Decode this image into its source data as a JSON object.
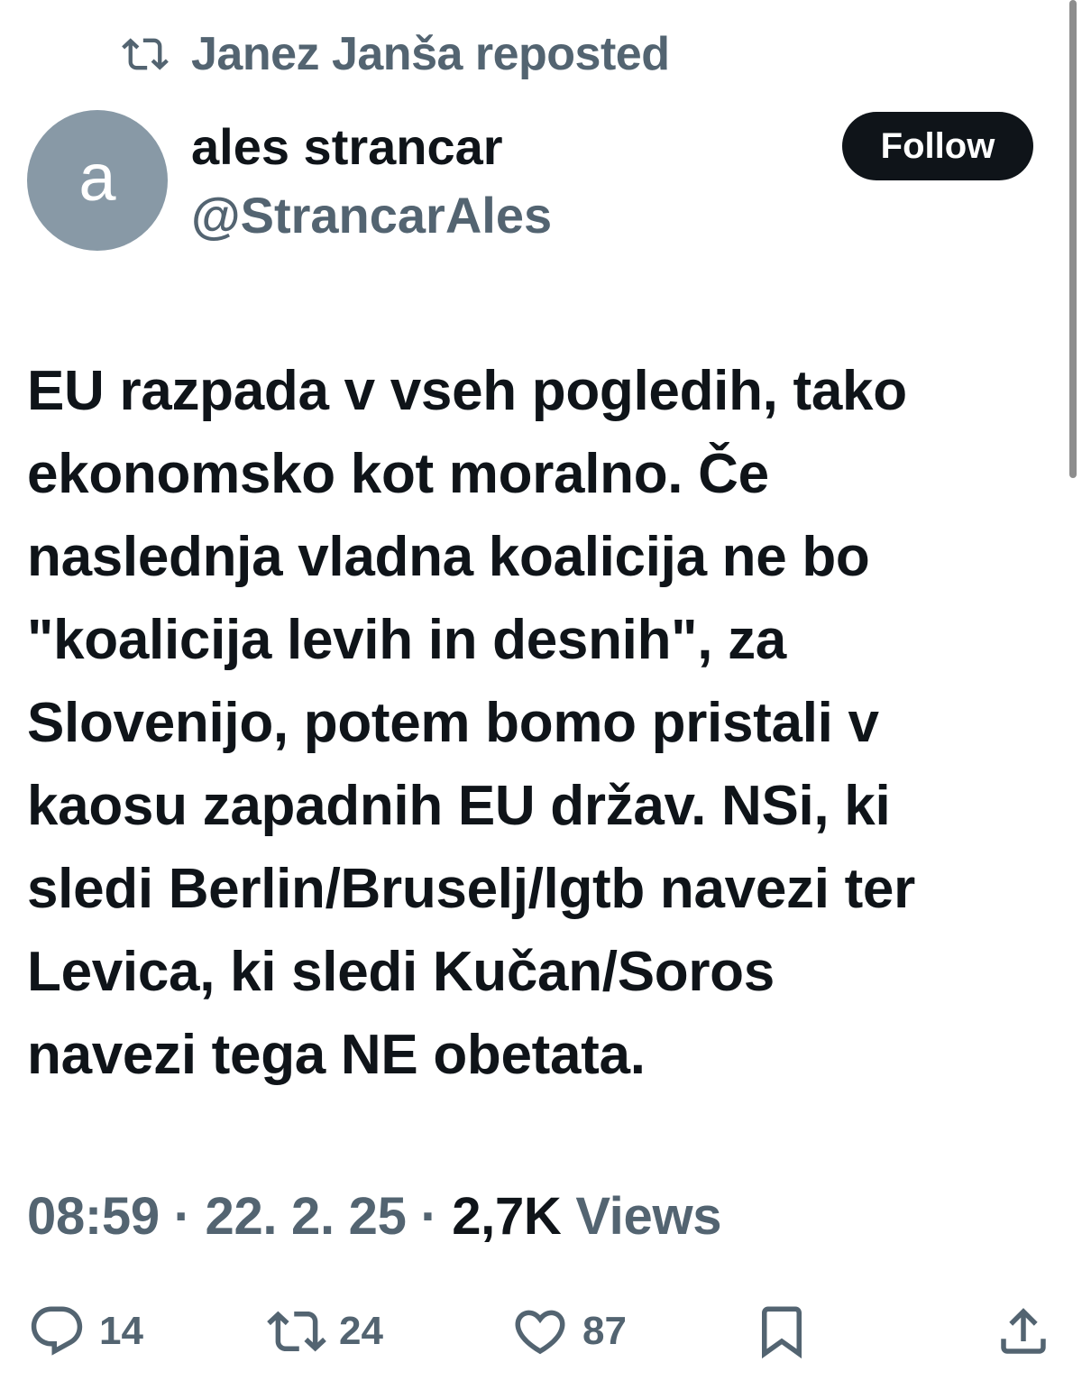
{
  "repost": {
    "text": "Janez Janša reposted",
    "icon": "repost-icon"
  },
  "author": {
    "avatar_letter": "a",
    "avatar_color": "#8899a6",
    "name": "ales strancar",
    "handle": "@StrancarAles"
  },
  "follow_label": "Follow",
  "tweet": {
    "text": "EU razpada v vseh pogledih, tako\nekonomsko kot moralno. Če\nnaslednja vladna koalicija ne bo\n\"koalicija levih in desnih\", za\nSlovenijo, potem bomo pristali v\nkaosu zapadnih EU držav. NSi, ki\nsledi Berlin/Bruselj/lgtb navezi ter\nLevica, ki sledi Kučan/Soros\nnavezi tega NE obetata."
  },
  "meta": {
    "time": "08:59",
    "separator": " · ",
    "date": "22. 2. 25",
    "views_count": "2,7K",
    "views_label": " Views"
  },
  "actions": {
    "replies": "14",
    "reposts": "24",
    "likes": "87"
  },
  "colors": {
    "text_primary": "#0f1419",
    "text_secondary": "#536471",
    "button_bg": "#0f1419"
  }
}
